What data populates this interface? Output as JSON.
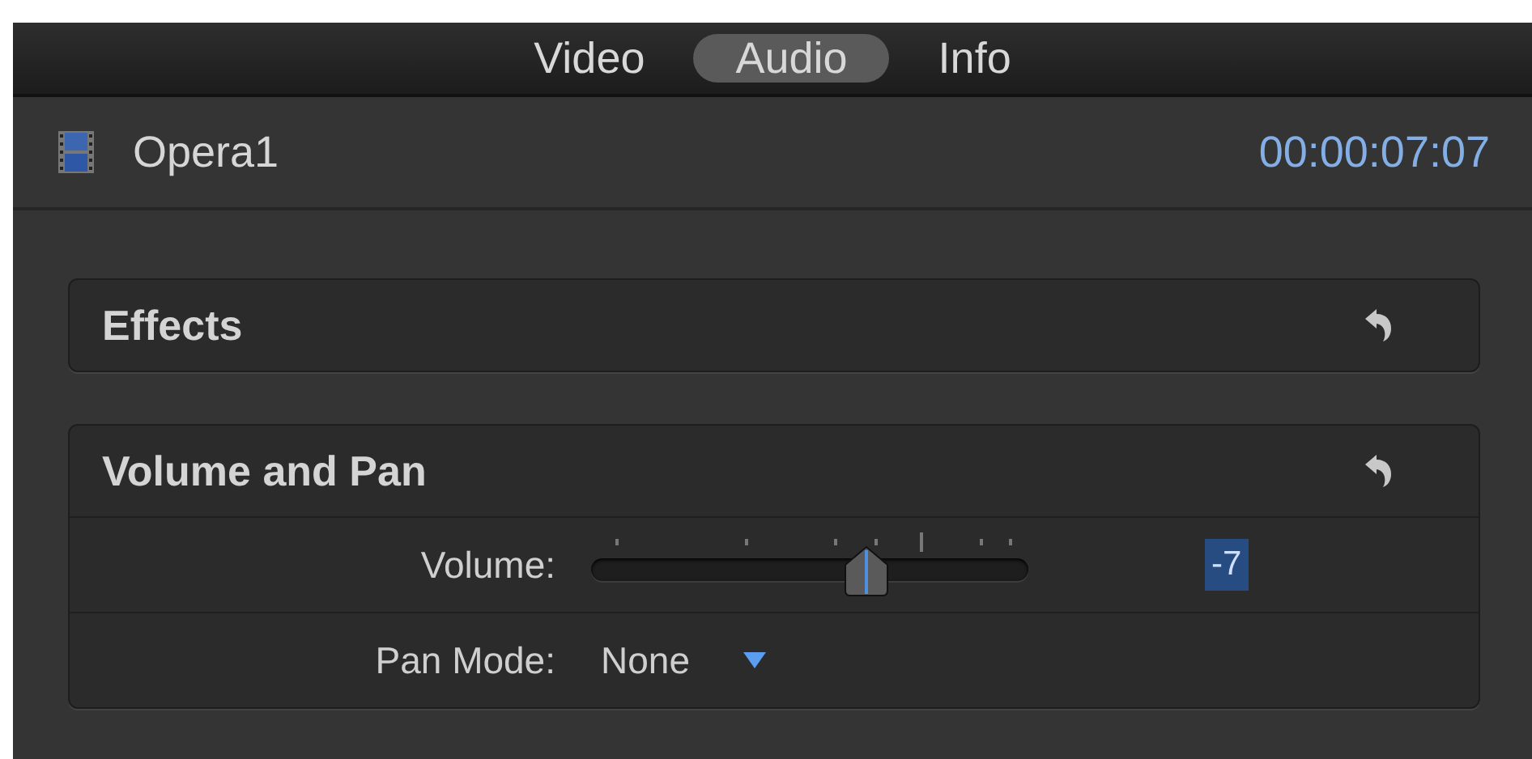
{
  "tabs": [
    {
      "label": "Video",
      "selected": false
    },
    {
      "label": "Audio",
      "selected": true
    },
    {
      "label": "Info",
      "selected": false
    }
  ],
  "clip": {
    "name": "Opera1",
    "timecode": "00:00:07:07"
  },
  "sections": [
    {
      "title": "Effects"
    },
    {
      "title": "Volume and Pan",
      "rows": [
        {
          "kind": "slider",
          "label": "Volume:",
          "level": 0.63,
          "value": "-7"
        },
        {
          "kind": "popup",
          "label": "Pan Mode:",
          "value": "None"
        }
      ]
    }
  ]
}
